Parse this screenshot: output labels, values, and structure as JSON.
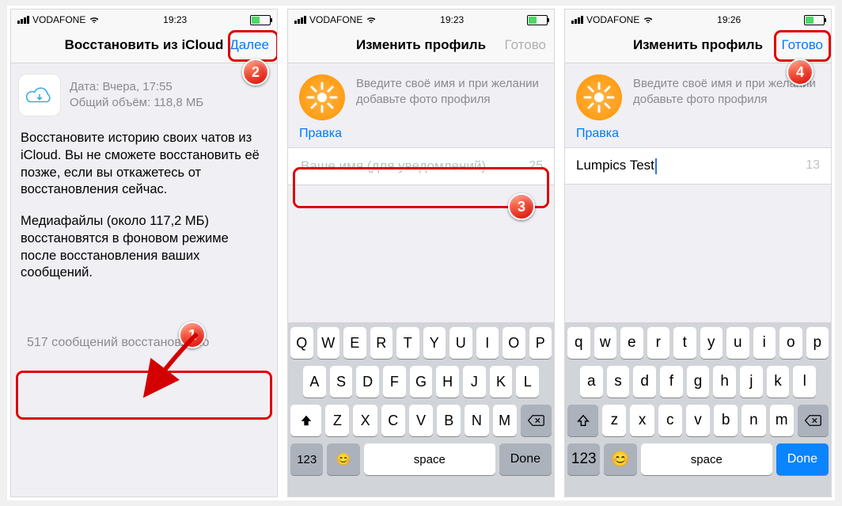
{
  "screens": [
    {
      "status": {
        "carrier": "VODAFONE",
        "time": "19:23"
      },
      "nav": {
        "title": "Восстановить из iCloud",
        "right": "Далее",
        "right_enabled": true
      },
      "backup": {
        "date_label": "Дата: Вчера, 17:55",
        "size_label": "Общий объём: 118,8 МБ"
      },
      "para1": "Восстановите историю своих чатов из iCloud. Вы не сможете восстановить её позже, если вы откажетесь от восстановления сейчас.",
      "para2": "Медиафайлы (около 117,2 МБ) восстановятся в фоновом режиме после восстановления ваших сообщений.",
      "restored": "517 сообщений восстановлено"
    },
    {
      "status": {
        "carrier": "VODAFONE",
        "time": "19:23"
      },
      "nav": {
        "title": "Изменить профиль",
        "right": "Готово",
        "right_enabled": false
      },
      "hint": "Введите своё имя и при желании добавьте фото профиля",
      "edit": "Правка",
      "name_value": "",
      "name_placeholder": "Ваше имя (для уведомлений)",
      "name_count": "25",
      "keyboard": {
        "case": "upper",
        "rows": [
          [
            "Q",
            "W",
            "E",
            "R",
            "T",
            "Y",
            "U",
            "I",
            "O",
            "P"
          ],
          [
            "A",
            "S",
            "D",
            "F",
            "G",
            "H",
            "J",
            "K",
            "L"
          ],
          [
            "Z",
            "X",
            "C",
            "V",
            "B",
            "N",
            "M"
          ]
        ],
        "num": "123",
        "space": "space",
        "done": "Done",
        "done_active": false
      }
    },
    {
      "status": {
        "carrier": "VODAFONE",
        "time": "19:26"
      },
      "nav": {
        "title": "Изменить профиль",
        "right": "Готово",
        "right_enabled": true
      },
      "hint": "Введите своё имя и при желании добавьте фото профиля",
      "edit": "Правка",
      "name_value": "Lumpics Test",
      "name_placeholder": "Ваше имя (для уведомлений)",
      "name_count": "13",
      "keyboard": {
        "case": "lower",
        "rows": [
          [
            "q",
            "w",
            "e",
            "r",
            "t",
            "y",
            "u",
            "i",
            "o",
            "p"
          ],
          [
            "a",
            "s",
            "d",
            "f",
            "g",
            "h",
            "j",
            "k",
            "l"
          ],
          [
            "z",
            "x",
            "c",
            "v",
            "b",
            "n",
            "m"
          ]
        ],
        "num": "123",
        "space": "space",
        "done": "Done",
        "done_active": true
      }
    }
  ],
  "markers": [
    "1",
    "2",
    "3",
    "4"
  ]
}
